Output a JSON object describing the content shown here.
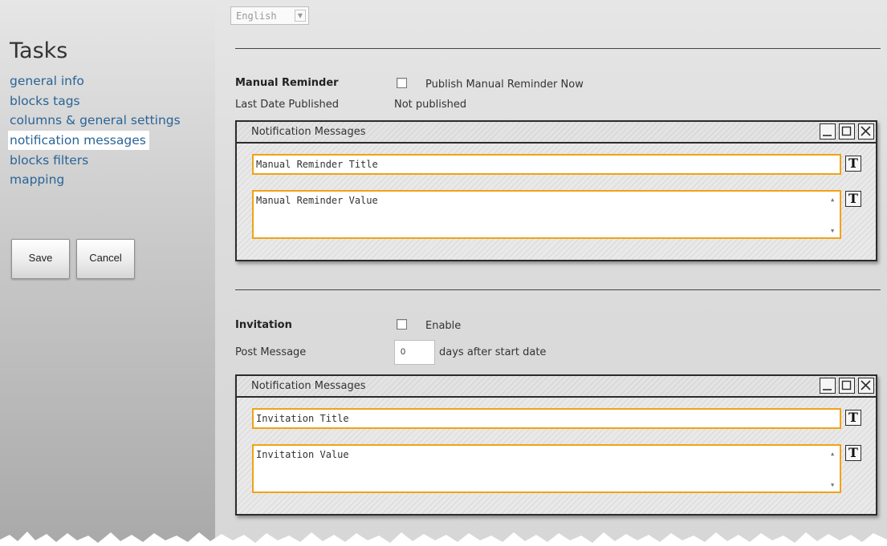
{
  "sidebar": {
    "title": "Tasks",
    "nav": [
      {
        "label": "general info",
        "active": false
      },
      {
        "label": "blocks tags",
        "active": false
      },
      {
        "label": "columns & general settings",
        "active": false
      },
      {
        "label": "notification messages",
        "active": true
      },
      {
        "label": "blocks filters",
        "active": false
      },
      {
        "label": "mapping",
        "active": false
      }
    ],
    "save_label": "Save",
    "cancel_label": "Cancel"
  },
  "language": {
    "selected": "English"
  },
  "manual_reminder": {
    "label": "Manual Reminder",
    "publish_checkbox_label": "Publish Manual Reminder Now",
    "publish_checked": false,
    "last_date_label": "Last Date Published",
    "last_date_value": "Not published",
    "window": {
      "title": "Notification Messages",
      "title_field": "Manual Reminder Title",
      "value_field": "Manual Reminder Value"
    }
  },
  "invitation": {
    "label": "Invitation",
    "enable_label": "Enable",
    "enable_checked": false,
    "post_message_label": "Post Message",
    "post_message_value": "0",
    "post_message_suffix": "days after start date",
    "window": {
      "title": "Notification Messages",
      "title_field": "Invitation Title",
      "value_field": "Invitation Value"
    }
  },
  "icons": {
    "minimize": "minimize-icon",
    "maximize": "maximize-icon",
    "close": "close-icon",
    "text_format": "text-format-icon",
    "dropdown": "chevron-down-icon"
  },
  "colors": {
    "link": "#2a6496",
    "field_border": "#f0a316",
    "window_border": "#2c2c2c"
  }
}
